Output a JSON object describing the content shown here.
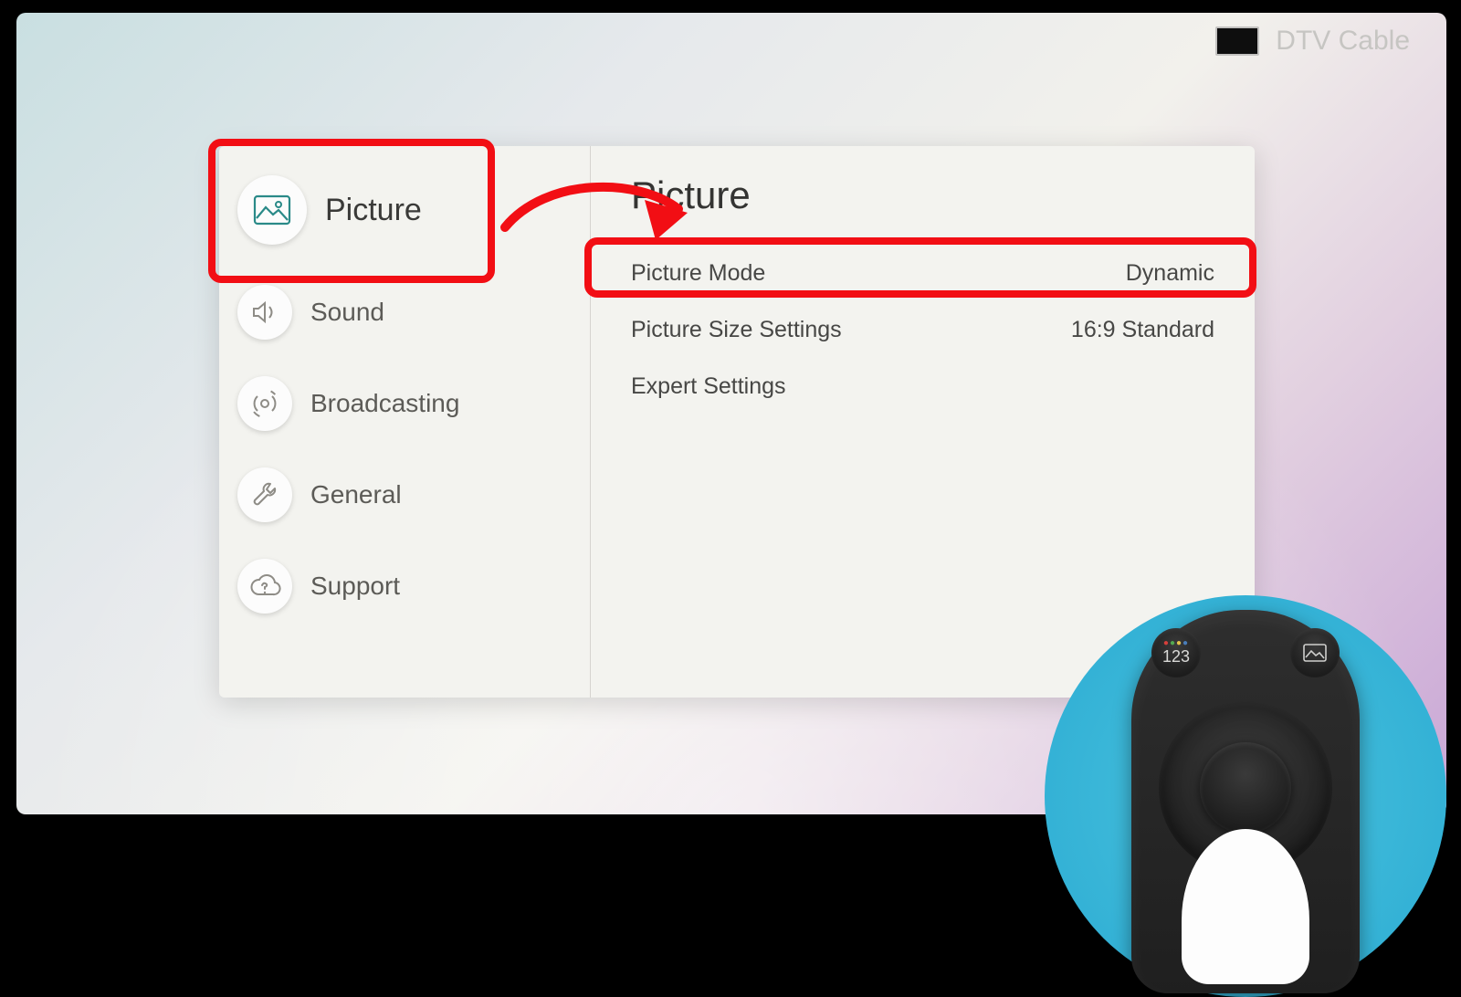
{
  "status": {
    "source": "DTV Cable"
  },
  "sidebar": {
    "items": [
      {
        "id": "picture",
        "label": "Picture",
        "icon": "picture-icon",
        "active": true
      },
      {
        "id": "sound",
        "label": "Sound",
        "icon": "sound-icon",
        "active": false
      },
      {
        "id": "broadcasting",
        "label": "Broadcasting",
        "icon": "broadcast-icon",
        "active": false
      },
      {
        "id": "general",
        "label": "General",
        "icon": "wrench-icon",
        "active": false
      },
      {
        "id": "support",
        "label": "Support",
        "icon": "cloud-help-icon",
        "active": false
      }
    ]
  },
  "content": {
    "title": "Picture",
    "rows": [
      {
        "id": "picture-mode",
        "label": "Picture Mode",
        "value": "Dynamic",
        "highlighted": true
      },
      {
        "id": "picture-size",
        "label": "Picture Size Settings",
        "value": "16:9 Standard",
        "highlighted": false
      },
      {
        "id": "expert",
        "label": "Expert Settings",
        "value": "",
        "highlighted": false
      }
    ]
  },
  "remote": {
    "keypad_label": "123"
  },
  "annotations": {
    "sidebar_highlight": "Picture",
    "row_highlight": "Picture Mode",
    "arrow_color": "#f20e14"
  }
}
